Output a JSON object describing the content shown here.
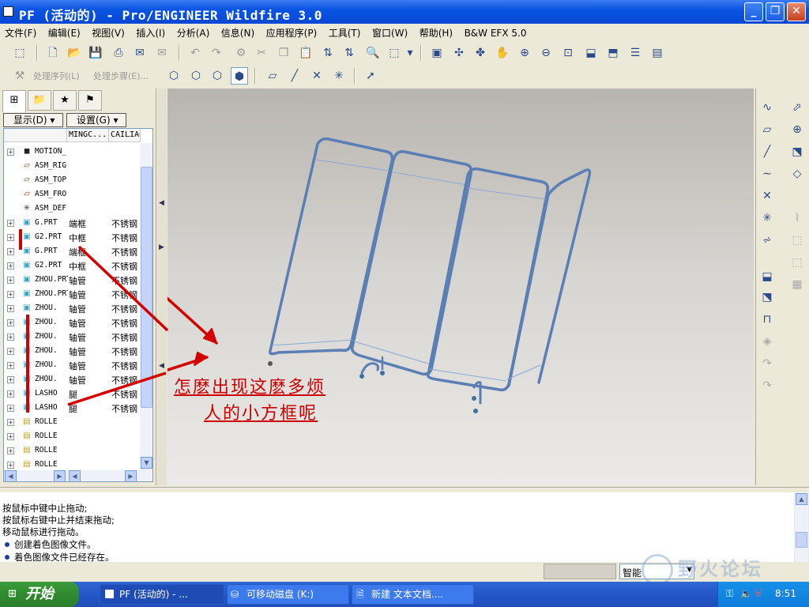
{
  "window": {
    "title": "PF (活动的) - Pro/ENGINEER Wildfire 3.0"
  },
  "menu": [
    "文件(F)",
    "编辑(E)",
    "视图(V)",
    "插入(I)",
    "分析(A)",
    "信息(N)",
    "应用程序(P)",
    "工具(T)",
    "窗口(W)",
    "帮助(H)",
    "B&W EFX 5.0"
  ],
  "toolbar2": {
    "seq_label": "处理序列(L)",
    "step_label": "处理步骤(E)..."
  },
  "navigator": {
    "show_button": "显示(D)",
    "settings_button": "设置(G)",
    "columns": [
      "MINGC...",
      "CAILIAO"
    ],
    "rows": [
      {
        "name": "MOTION_",
        "c2": "",
        "c3": "",
        "icon": "motion-icon"
      },
      {
        "name": "ASM_RIG",
        "c2": "",
        "c3": "",
        "icon": "datum-plane-icon"
      },
      {
        "name": "ASM_TOP",
        "c2": "",
        "c3": "",
        "icon": "datum-plane-icon"
      },
      {
        "name": "ASM_FRO",
        "c2": "",
        "c3": "",
        "icon": "datum-plane-icon"
      },
      {
        "name": "ASM_DEF",
        "c2": "",
        "c3": "",
        "icon": "csys-icon"
      },
      {
        "name": "G.PRT",
        "c2": "端框",
        "c3": "不锈钢",
        "icon": "part-icon"
      },
      {
        "name": "G2.PRT",
        "c2": "中框",
        "c3": "不锈钢",
        "icon": "part-icon"
      },
      {
        "name": "G.PRT",
        "c2": "端框",
        "c3": "不锈钢",
        "icon": "part-icon"
      },
      {
        "name": "G2.PRT",
        "c2": "中框",
        "c3": "不锈钢",
        "icon": "part-icon"
      },
      {
        "name": "ZHOU.PRT",
        "c2": "轴管",
        "c3": "不锈钢",
        "icon": "part-icon"
      },
      {
        "name": "ZHOU.PRT",
        "c2": "轴管",
        "c3": "不锈钢",
        "icon": "part-icon"
      },
      {
        "name": "ZHOU.",
        "c2": "轴管",
        "c3": "不锈钢",
        "icon": "part-icon"
      },
      {
        "name": "ZHOU.",
        "c2": "轴管",
        "c3": "不锈钢",
        "icon": "part-icon"
      },
      {
        "name": "ZHOU.",
        "c2": "轴管",
        "c3": "不锈钢",
        "icon": "part-icon"
      },
      {
        "name": "ZHOU.",
        "c2": "轴管",
        "c3": "不锈钢",
        "icon": "part-icon"
      },
      {
        "name": "ZHOU.",
        "c2": "轴管",
        "c3": "不锈钢",
        "icon": "part-icon"
      },
      {
        "name": "ZHOU.",
        "c2": "轴管",
        "c3": "不锈钢",
        "icon": "part-icon"
      },
      {
        "name": "LASHO",
        "c2": "腿",
        "c3": "不锈钢",
        "icon": "part-icon"
      },
      {
        "name": "LASHO",
        "c2": "腿",
        "c3": "不锈钢",
        "icon": "part-icon"
      },
      {
        "name": "ROLLE",
        "c2": "",
        "c3": "",
        "icon": "subasm-icon"
      },
      {
        "name": "ROLLE",
        "c2": "",
        "c3": "",
        "icon": "subasm-icon"
      },
      {
        "name": "ROLLE",
        "c2": "",
        "c3": "",
        "icon": "subasm-icon"
      },
      {
        "name": "ROLLE",
        "c2": "",
        "c3": "",
        "icon": "subasm-icon"
      }
    ]
  },
  "annotation": {
    "line1": "怎麽出现这麽多烦",
    "line2": "人的小方框呢"
  },
  "messages": [
    {
      "text": "按鼠标中键中止拖动;",
      "bullet": false
    },
    {
      "text": "按鼠标右键中止并结束拖动;",
      "bullet": false
    },
    {
      "text": "移动鼠标进行拖动。",
      "bullet": false
    },
    {
      "text": "创建着色图像文件。",
      "bullet": true
    },
    {
      "text": "着色图像文件已经存在。",
      "bullet": true
    }
  ],
  "status": {
    "filter": "智能"
  },
  "taskbar": {
    "start": "开始",
    "tasks": [
      "PF (活动的) - ...",
      "可移动磁盘 (K:)",
      "新建 文本文档...."
    ],
    "clock": "8:51"
  },
  "watermark": "野火论坛",
  "colors": {
    "accent_blue": "#0a54e3",
    "annotation_red": "#cc0000",
    "frame_blue": "#7ea6d8"
  }
}
